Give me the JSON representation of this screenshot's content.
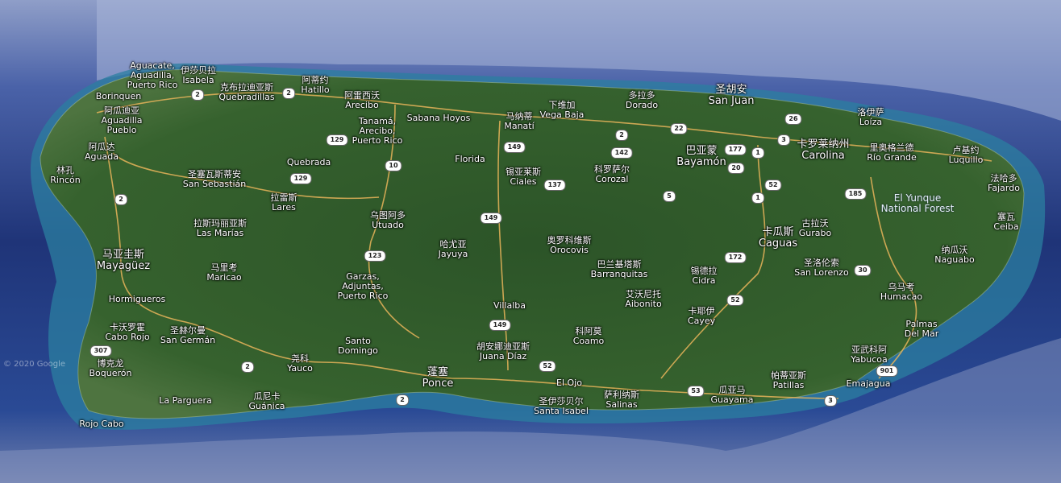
{
  "map": {
    "copyright": "© 2020 Google",
    "colors": {
      "ocean_deep": "#1d2f6e",
      "ocean_shallow": "#2f8aa6",
      "land": "#2f5a2a",
      "road": "#e8b45a"
    },
    "places": [
      {
        "id": "aguadilla",
        "zh": "Aguacate,\nAguadilla,\nPuerto Rico",
        "en": ""
      },
      {
        "id": "isabela",
        "zh": "伊莎贝拉",
        "en": "Isabela"
      },
      {
        "id": "quebradillas",
        "zh": "克布拉迪亚斯",
        "en": "Quebradillas"
      },
      {
        "id": "hatillo",
        "zh": "阿蒂约",
        "en": "Hatillo"
      },
      {
        "id": "arecibo",
        "zh": "阿雷西沃",
        "en": "Arecibo"
      },
      {
        "id": "tanama",
        "zh": "Tanamá,\nArecibo,\nPuerto Rico",
        "en": ""
      },
      {
        "id": "borinquen",
        "zh": "Borinquen",
        "en": ""
      },
      {
        "id": "aguadilla2",
        "zh": "阿瓜迪亚",
        "en": "Aguadilla\nPueblo"
      },
      {
        "id": "aguada",
        "zh": "阿瓜达",
        "en": "Aguada"
      },
      {
        "id": "rincon",
        "zh": "林孔",
        "en": "Rincón"
      },
      {
        "id": "sansebastian",
        "zh": "圣塞瓦斯蒂安",
        "en": "San Sebastián"
      },
      {
        "id": "quebrada",
        "zh": "Quebrada",
        "en": ""
      },
      {
        "id": "lares",
        "zh": "拉雷斯",
        "en": "Lares"
      },
      {
        "id": "sabana",
        "zh": "Sabana Hoyos",
        "en": ""
      },
      {
        "id": "manati",
        "zh": "马纳蒂",
        "en": "Manatí"
      },
      {
        "id": "vegabaja",
        "zh": "下维加",
        "en": "Vega Baja"
      },
      {
        "id": "dorado",
        "zh": "多拉多",
        "en": "Dorado"
      },
      {
        "id": "sanjuan",
        "zh": "圣胡安",
        "en": "San Juan"
      },
      {
        "id": "loiza",
        "zh": "洛伊萨",
        "en": "Loíza"
      },
      {
        "id": "carolina",
        "zh": "卡罗莱纳州",
        "en": "Carolina"
      },
      {
        "id": "riogrande",
        "zh": "里奥格兰德",
        "en": "Río Grande"
      },
      {
        "id": "luquillo",
        "zh": "卢基约",
        "en": "Luquillo"
      },
      {
        "id": "fajardo",
        "zh": "法哈多",
        "en": "Fajardo"
      },
      {
        "id": "bayamon",
        "zh": "巴亚蒙",
        "en": "Bayamón"
      },
      {
        "id": "florida",
        "zh": "Florida",
        "en": ""
      },
      {
        "id": "ciales",
        "zh": "锡亚莱斯",
        "en": "Ciales"
      },
      {
        "id": "corozal",
        "zh": "科罗萨尔",
        "en": "Corozal"
      },
      {
        "id": "utuado",
        "zh": "乌图阿多",
        "en": "Utuado"
      },
      {
        "id": "lasmarias",
        "zh": "拉斯玛丽亚斯",
        "en": "Las Marías"
      },
      {
        "id": "mayaguez",
        "zh": "马亚圭斯",
        "en": "Mayagüez"
      },
      {
        "id": "maricao",
        "zh": "马里考",
        "en": "Maricao"
      },
      {
        "id": "jayuya",
        "zh": "哈尤亚",
        "en": "Jayuya"
      },
      {
        "id": "orocovis",
        "zh": "奥罗科维斯",
        "en": "Orocovis"
      },
      {
        "id": "barranquitas",
        "zh": "巴兰基塔斯",
        "en": "Barranquitas"
      },
      {
        "id": "caguas",
        "zh": "卡瓜斯",
        "en": "Caguas"
      },
      {
        "id": "gurabo",
        "zh": "古拉沃",
        "en": "Gurabo"
      },
      {
        "id": "yunque",
        "zh": "El Yunque\nNational Forest",
        "en": ""
      },
      {
        "id": "ceiba",
        "zh": "塞瓦",
        "en": "Ceiba"
      },
      {
        "id": "naguabo",
        "zh": "纳瓜沃",
        "en": "Naguabo"
      },
      {
        "id": "sanlorenzo",
        "zh": "圣洛伦索",
        "en": "San Lorenzo"
      },
      {
        "id": "cidra",
        "zh": "锡德拉",
        "en": "Cidra"
      },
      {
        "id": "aibonito",
        "zh": "艾沃尼托",
        "en": "Aibonito"
      },
      {
        "id": "cayey",
        "zh": "卡耶伊",
        "en": "Cayey"
      },
      {
        "id": "humacao",
        "zh": "乌马考",
        "en": "Humacao"
      },
      {
        "id": "palmas",
        "zh": "Palmas\nDel Mar",
        "en": ""
      },
      {
        "id": "yabucoa",
        "zh": "亚武科阿",
        "en": "Yabucoa"
      },
      {
        "id": "emajagua",
        "zh": "Emajagua",
        "en": ""
      },
      {
        "id": "patillas",
        "zh": "帕蒂亚斯",
        "en": "Patillas"
      },
      {
        "id": "guayama",
        "zh": "瓜亚马",
        "en": "Guayama"
      },
      {
        "id": "salinas",
        "zh": "萨利纳斯",
        "en": "Salinas"
      },
      {
        "id": "santaisabel",
        "zh": "圣伊莎贝尔",
        "en": "Santa Isabel"
      },
      {
        "id": "coamo",
        "zh": "科阿莫",
        "en": "Coamo"
      },
      {
        "id": "juanadiaz",
        "zh": "胡安娜迪亚斯",
        "en": "Juana Díaz"
      },
      {
        "id": "villalba",
        "zh": "Villalba",
        "en": ""
      },
      {
        "id": "elojo",
        "zh": "El Ojo",
        "en": ""
      },
      {
        "id": "ponce",
        "zh": "蓬塞",
        "en": "Ponce"
      },
      {
        "id": "garzas",
        "zh": "Garzas,\nAdjuntas,\nPuerto Rico",
        "en": ""
      },
      {
        "id": "santodomingo",
        "zh": "Santo\nDomingo",
        "en": ""
      },
      {
        "id": "yauco",
        "zh": "尧科",
        "en": "Yauco"
      },
      {
        "id": "guanica",
        "zh": "瓜尼卡",
        "en": "Guánica"
      },
      {
        "id": "laparguera",
        "zh": "La Parguera",
        "en": ""
      },
      {
        "id": "sangerman",
        "zh": "圣赫尔曼",
        "en": "San Germán"
      },
      {
        "id": "hormigueros",
        "zh": "Hormigueros",
        "en": ""
      },
      {
        "id": "caborojo",
        "zh": "卡沃罗霍",
        "en": "Cabo Rojo"
      },
      {
        "id": "boqueron",
        "zh": "博克龙",
        "en": "Boquerón"
      },
      {
        "id": "rojocabo",
        "zh": "Rojo Cabo",
        "en": ""
      }
    ],
    "shields": [
      {
        "id": "r2a",
        "num": "2"
      },
      {
        "id": "r2b",
        "num": "2"
      },
      {
        "id": "r129a",
        "num": "129"
      },
      {
        "id": "r129b",
        "num": "129"
      },
      {
        "id": "r10",
        "num": "10"
      },
      {
        "id": "r149a",
        "num": "149"
      },
      {
        "id": "r149b",
        "num": "149"
      },
      {
        "id": "r149c",
        "num": "149"
      },
      {
        "id": "r137",
        "num": "137"
      },
      {
        "id": "r2c",
        "num": "2"
      },
      {
        "id": "r142",
        "num": "142"
      },
      {
        "id": "r22",
        "num": "22"
      },
      {
        "id": "r177",
        "num": "177"
      },
      {
        "id": "r1a",
        "num": "1"
      },
      {
        "id": "r3a",
        "num": "3"
      },
      {
        "id": "r26",
        "num": "26"
      },
      {
        "id": "r20",
        "num": "20"
      },
      {
        "id": "r52a",
        "num": "52"
      },
      {
        "id": "r1b",
        "num": "1"
      },
      {
        "id": "r5",
        "num": "5"
      },
      {
        "id": "r185",
        "num": "185"
      },
      {
        "id": "r2d",
        "num": "2"
      },
      {
        "id": "r123",
        "num": "123"
      },
      {
        "id": "r172",
        "num": "172"
      },
      {
        "id": "r52b",
        "num": "52"
      },
      {
        "id": "r30",
        "num": "30"
      },
      {
        "id": "r307",
        "num": "307"
      },
      {
        "id": "r2e",
        "num": "2"
      },
      {
        "id": "r2f",
        "num": "2"
      },
      {
        "id": "r52c",
        "num": "52"
      },
      {
        "id": "r53",
        "num": "53"
      },
      {
        "id": "r3b",
        "num": "3"
      },
      {
        "id": "r901",
        "num": "901"
      }
    ]
  }
}
